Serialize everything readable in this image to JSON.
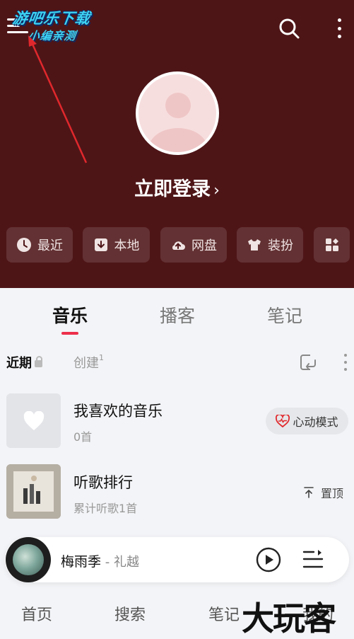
{
  "watermark": {
    "line1": "游吧乐下载",
    "line2": "小编亲测"
  },
  "header": {
    "menu_icon": "hamburger-menu-icon",
    "search_icon": "search-icon",
    "more_icon": "vertical-dots-icon",
    "bg_color": "#4e1517"
  },
  "profile": {
    "login_label": "立即登录",
    "chevron": "›"
  },
  "quick_actions": [
    {
      "label": "最近",
      "icon": "clock-icon"
    },
    {
      "label": "本地",
      "icon": "download-box-icon"
    },
    {
      "label": "网盘",
      "icon": "cloud-upload-icon"
    },
    {
      "label": "装扮",
      "icon": "shirt-icon"
    },
    {
      "label": "",
      "icon": "grid-apps-icon"
    }
  ],
  "tabs": [
    {
      "label": "音乐",
      "active": true
    },
    {
      "label": "播客",
      "active": false
    },
    {
      "label": "笔记",
      "active": false
    }
  ],
  "subtabs": {
    "recent": "近期",
    "created": "创建",
    "created_count": "1"
  },
  "playlists": [
    {
      "title": "我喜欢的音乐",
      "subtitle": "0首",
      "action": "心动模式"
    },
    {
      "title": "听歌排行",
      "subtitle": "累计听歌1首",
      "action": "置顶"
    }
  ],
  "player": {
    "song": "梅雨季",
    "separator": " - ",
    "artist": "礼越"
  },
  "bottom_nav": [
    "首页",
    "搜索",
    "笔记",
    "我的"
  ],
  "corner_watermark": "大玩客",
  "accent": "#ec2f4b"
}
